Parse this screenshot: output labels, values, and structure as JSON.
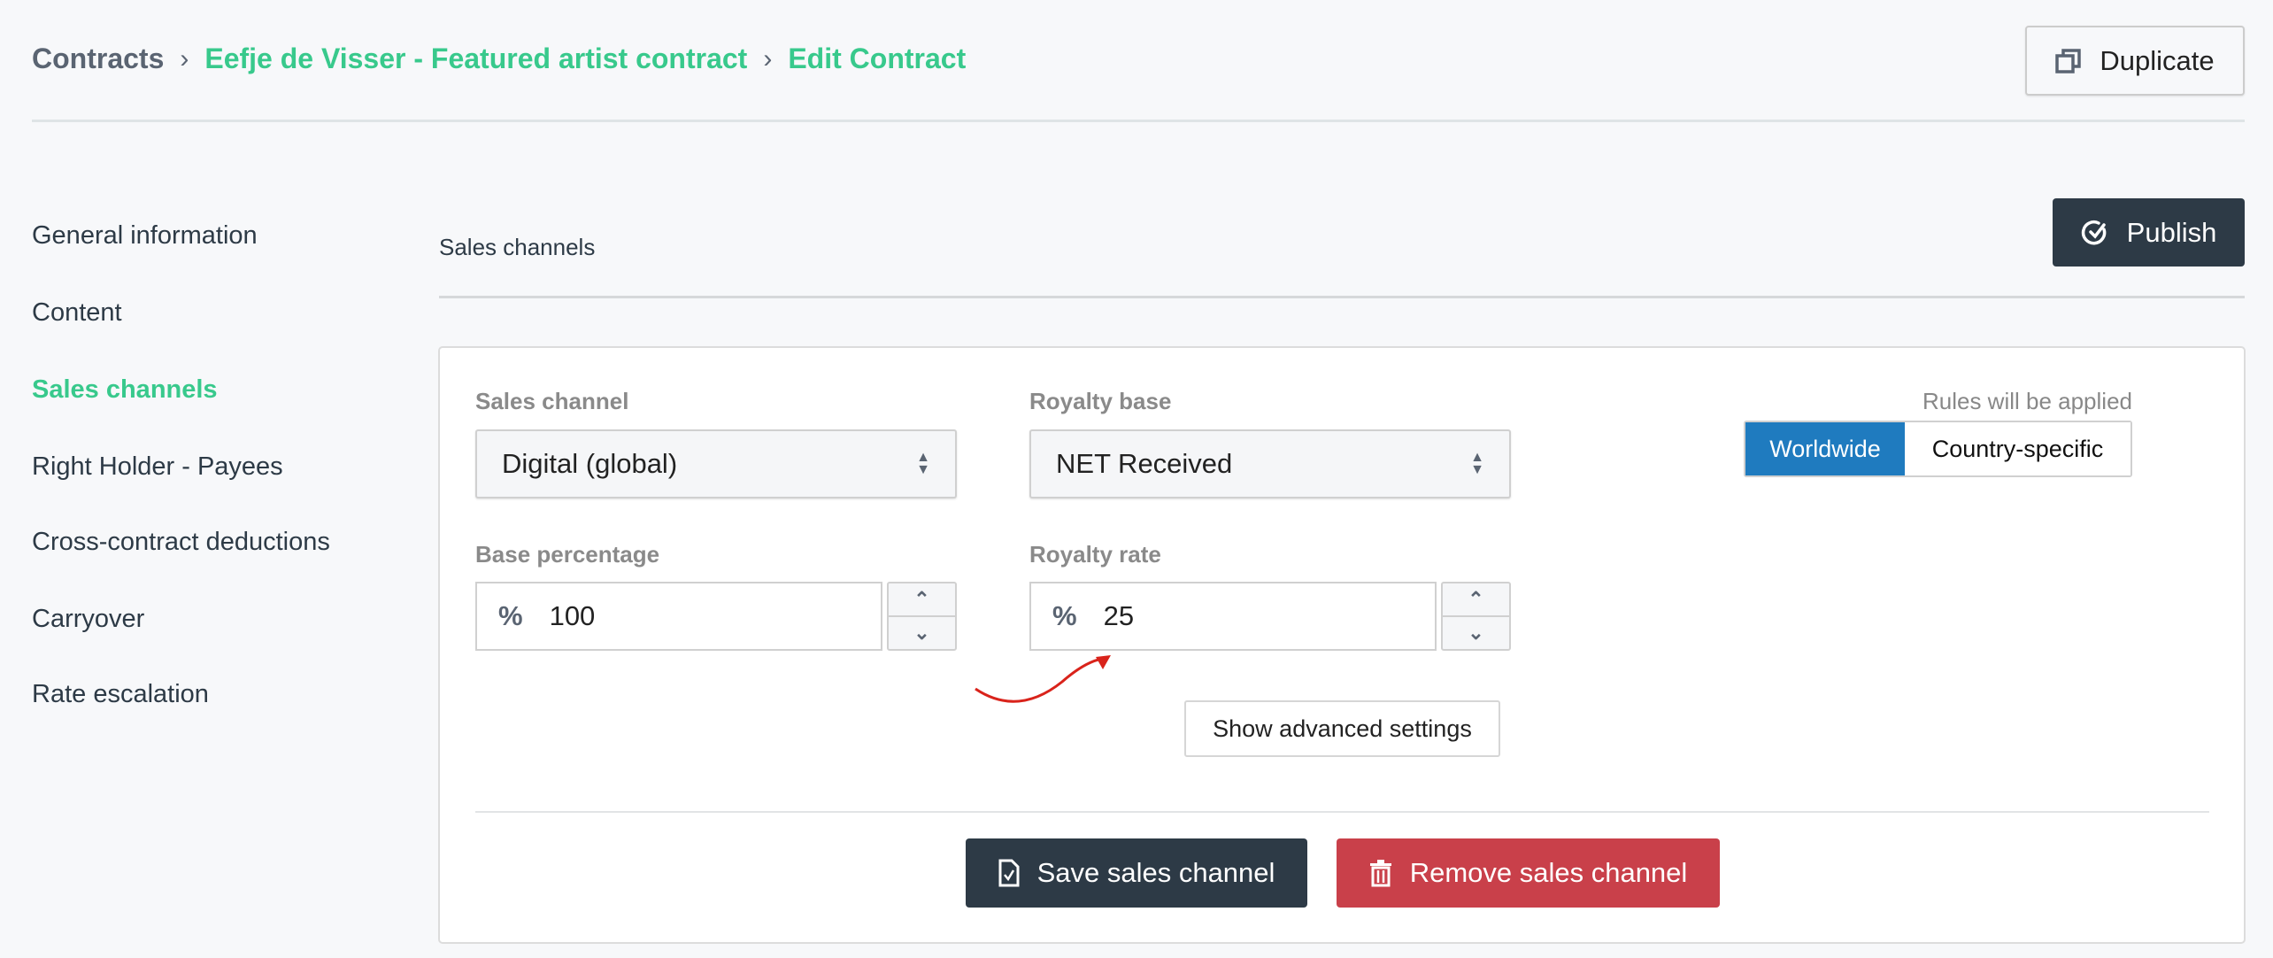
{
  "breadcrumb": {
    "root": "Contracts",
    "contract": "Eefje de Visser - Featured artist contract",
    "current": "Edit Contract",
    "separator": "›"
  },
  "header": {
    "duplicate_label": "Duplicate",
    "publish_label": "Publish"
  },
  "sidebar": {
    "items": [
      {
        "label": "General information"
      },
      {
        "label": "Content"
      },
      {
        "label": "Sales channels",
        "active": true
      },
      {
        "label": "Right Holder - Payees"
      },
      {
        "label": "Cross-contract deductions"
      },
      {
        "label": "Carryover"
      },
      {
        "label": "Rate escalation"
      }
    ]
  },
  "section": {
    "title": "Sales channels"
  },
  "form": {
    "sales_channel": {
      "label": "Sales channel",
      "value": "Digital (global)"
    },
    "royalty_base": {
      "label": "Royalty base",
      "value": "NET Received"
    },
    "base_percentage": {
      "label": "Base percentage",
      "unit": "%",
      "value": "100"
    },
    "royalty_rate": {
      "label": "Royalty rate",
      "unit": "%",
      "value": "25"
    },
    "rules": {
      "label": "Rules will be applied",
      "options": [
        "Worldwide",
        "Country-specific"
      ],
      "selected": "Worldwide"
    },
    "advanced_label": "Show advanced settings",
    "save_label": "Save sales channel",
    "remove_label": "Remove sales channel"
  },
  "colors": {
    "accent": "#38c98c",
    "dark": "#2d3a46",
    "danger": "#c9404a",
    "selected": "#1f7bbf"
  }
}
